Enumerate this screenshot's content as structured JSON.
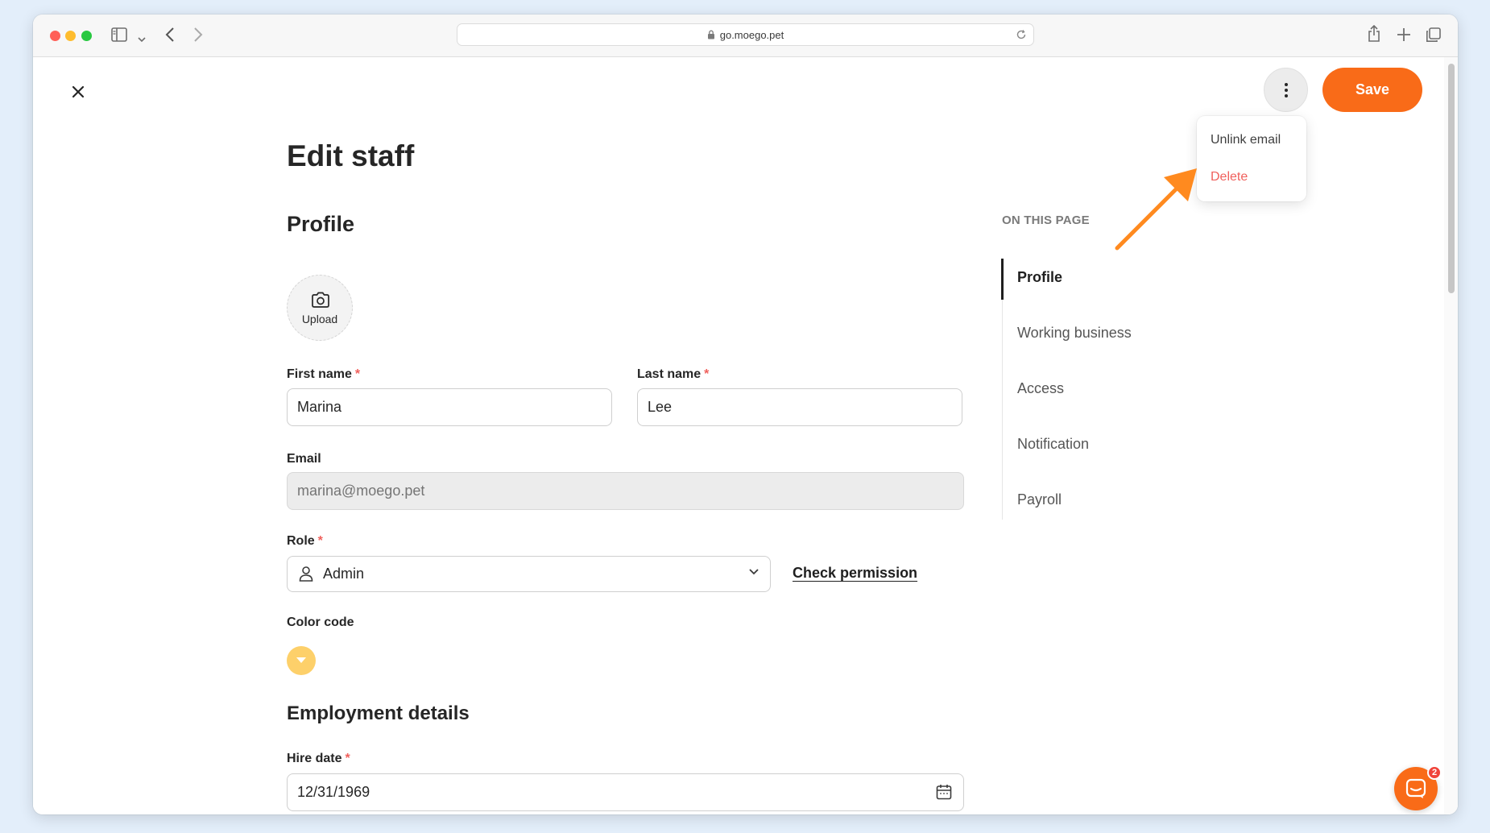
{
  "browser": {
    "url": "go.moego.pet"
  },
  "header": {
    "save_label": "Save"
  },
  "more_menu": {
    "unlink_label": "Unlink email",
    "delete_label": "Delete"
  },
  "page": {
    "title": "Edit staff"
  },
  "profile": {
    "section_title": "Profile",
    "upload_label": "Upload",
    "first_name_label": "First name",
    "first_name_value": "Marina",
    "last_name_label": "Last name",
    "last_name_value": "Lee",
    "email_label": "Email",
    "email_placeholder": "marina@moego.pet",
    "role_label": "Role",
    "role_value": "Admin",
    "check_permission_label": "Check permission",
    "color_code_label": "Color code",
    "color_code_value": "#fdd06a",
    "required_marker": "*"
  },
  "employment": {
    "section_title": "Employment details",
    "hire_date_label": "Hire date",
    "hire_date_value": "12/31/1969"
  },
  "toc": {
    "heading": "ON THIS PAGE",
    "items": [
      {
        "label": "Profile",
        "active": true
      },
      {
        "label": "Working business",
        "active": false
      },
      {
        "label": "Access",
        "active": false
      },
      {
        "label": "Notification",
        "active": false
      },
      {
        "label": "Payroll",
        "active": false
      }
    ]
  },
  "chat": {
    "badge_count": "2"
  },
  "colors": {
    "accent": "#f96b18",
    "danger": "#f0605c",
    "annotation_arrow": "#ff8a1f"
  }
}
